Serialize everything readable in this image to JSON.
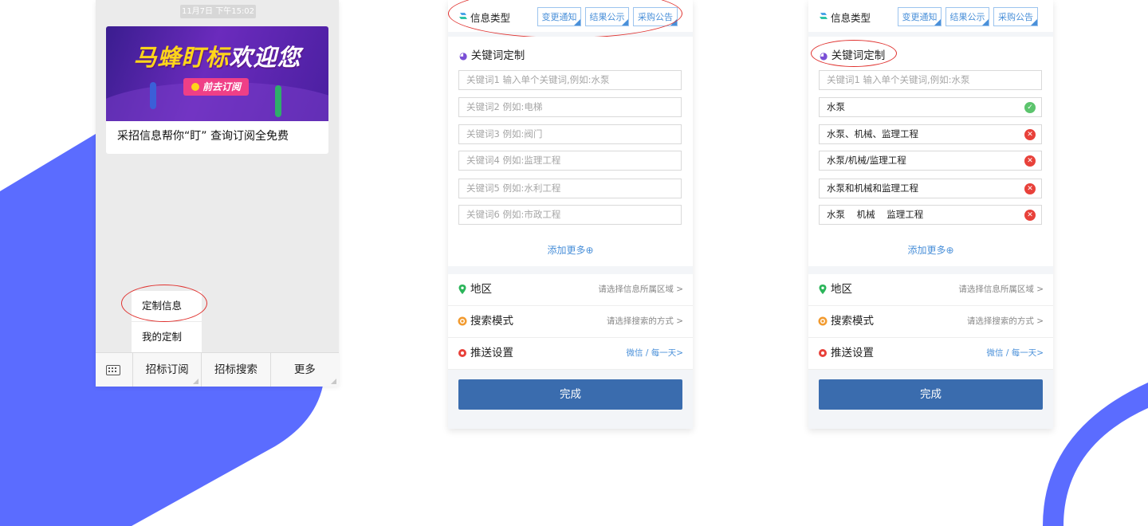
{
  "colors": {
    "accent_blue": "#5b6cff",
    "button_blue": "#3a6cae",
    "highlight_red": "#e0322f"
  },
  "wechat": {
    "timestamp": "11月7日 下午15:02",
    "banner_title_yellow": "马蜂盯标",
    "banner_title_white": "欢迎您",
    "banner_button": "前去订阅",
    "card_text": "采招信息帮你“盯” 查询订阅全免费",
    "menu_items": [
      "定制信息",
      "我的定制"
    ],
    "bottom_tabs": [
      "招标订阅",
      "招标搜索",
      "更多"
    ],
    "keyboard_icon": "keyboard-icon"
  },
  "form_left": {
    "info_type_label": "信息类型",
    "info_tags": [
      "变更通知",
      "结果公示",
      "采购公告"
    ],
    "keyword_title": "关键词定制",
    "keywords": [
      {
        "text": "关键词1  输入单个关键词,例如:水泵"
      },
      {
        "text": "关键词2  例如:电梯"
      },
      {
        "text": "关键词3  例如:阀门"
      },
      {
        "text": "关键词4  例如:监理工程"
      },
      {
        "text": "关键词5  例如:水利工程"
      },
      {
        "text": "关键词6  例如:市政工程"
      }
    ],
    "add_more": "添加更多⊕",
    "region_label": "地区",
    "region_value": "请选择信息所属区域 >",
    "search_label": "搜索模式",
    "search_value": "请选择搜索的方式 >",
    "push_label": "推送设置",
    "push_value": "微信 / 每一天>",
    "done": "完成"
  },
  "form_right": {
    "info_type_label": "信息类型",
    "info_tags": [
      "变更通知",
      "结果公示",
      "采购公告"
    ],
    "keyword_title": "关键词定制",
    "keywords": [
      {
        "text": "关键词1  输入单个关键词,例如:水泵",
        "status": ""
      },
      {
        "text": "水泵",
        "status": "valid"
      },
      {
        "text": "水泵、机械、监理工程",
        "status": "invalid"
      },
      {
        "text": "水泵/机械/监理工程",
        "status": "invalid"
      },
      {
        "text": "水泵和机械和监理工程",
        "status": "invalid"
      },
      {
        "text": "水泵    机械    监理工程",
        "status": "invalid"
      }
    ],
    "add_more": "添加更多⊕",
    "region_label": "地区",
    "region_value": "请选择信息所属区域 >",
    "search_label": "搜索模式",
    "search_value": "请选择搜索的方式 >",
    "push_label": "推送设置",
    "push_value": "微信 / 每一天>",
    "done": "完成"
  }
}
